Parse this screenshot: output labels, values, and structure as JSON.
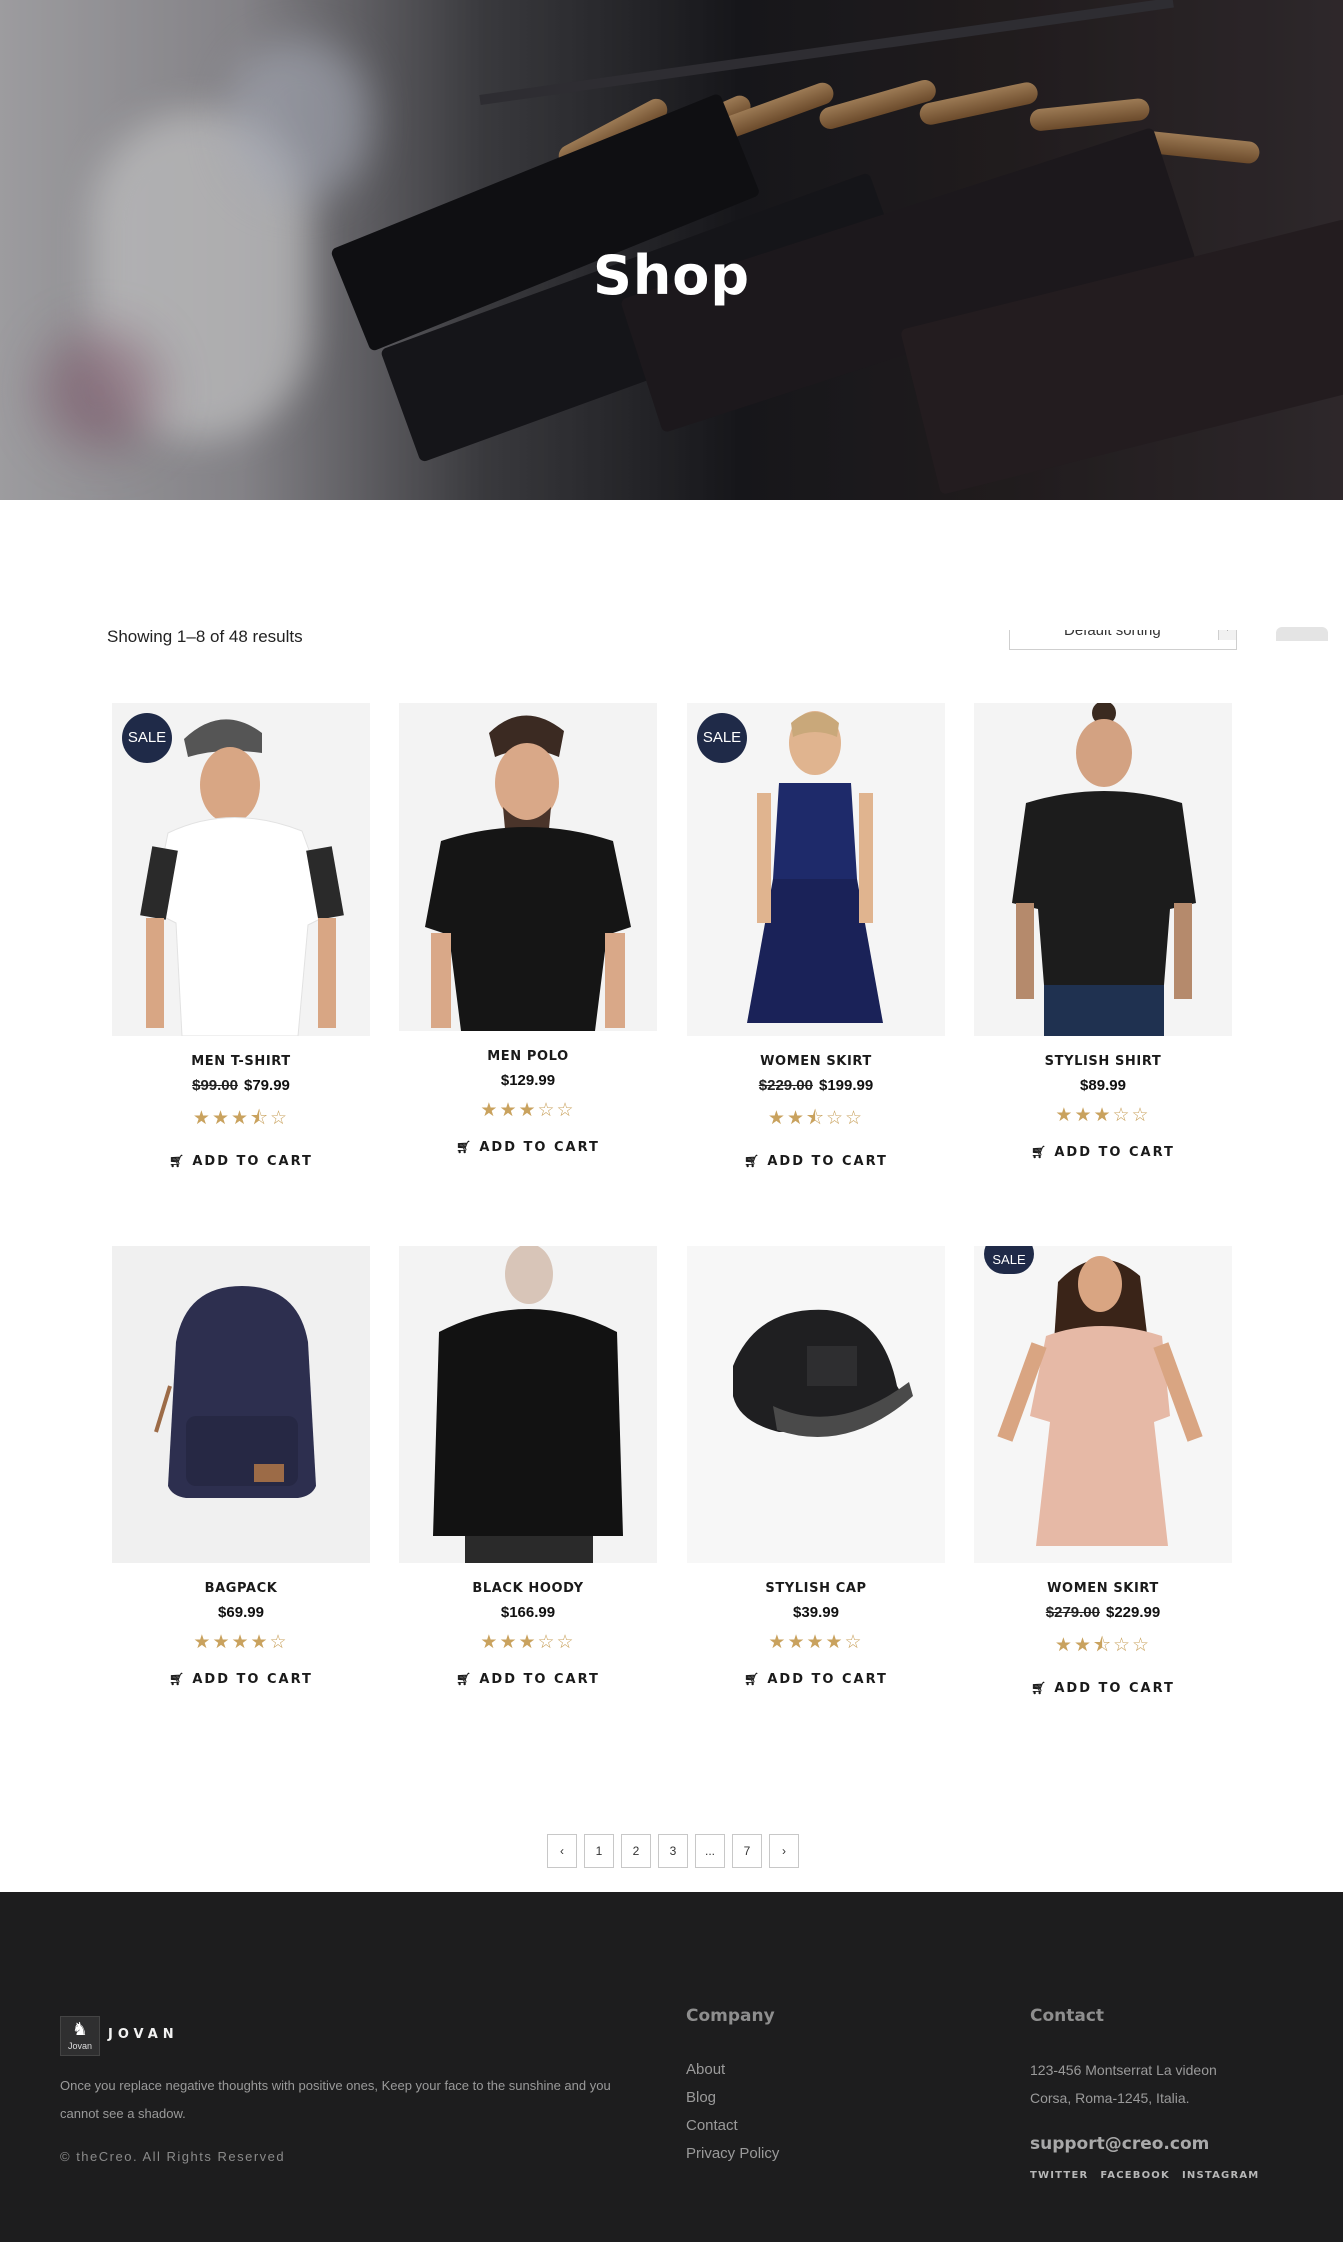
{
  "hero": {
    "title": "Shop"
  },
  "toolbar": {
    "result_count": "Showing 1–8 of 48 results",
    "sorting": "Default sorting"
  },
  "products": [
    {
      "name": "MEN T-SHIRT",
      "old_price": "$99.00",
      "price": "$79.99",
      "rating": "★★★⯪☆",
      "sale": "SALE",
      "cart": "ADD TO CART"
    },
    {
      "name": "MEN POLO",
      "old_price": "",
      "price": "$129.99",
      "rating": "★★★☆☆",
      "sale": "",
      "cart": "ADD TO CART"
    },
    {
      "name": "WOMEN SKIRT",
      "old_price": "$229.00",
      "price": "$199.99",
      "rating": "★★⯪☆☆",
      "sale": "SALE",
      "cart": "ADD TO CART"
    },
    {
      "name": "STYLISH SHIRT",
      "old_price": "",
      "price": "$89.99",
      "rating": "★★★☆☆",
      "sale": "",
      "cart": "ADD TO CART"
    },
    {
      "name": "BAGPACK",
      "old_price": "",
      "price": "$69.99",
      "rating": "★★★★☆",
      "sale": "",
      "cart": "ADD TO CART"
    },
    {
      "name": "BLACK HOODY",
      "old_price": "",
      "price": "$166.99",
      "rating": "★★★☆☆",
      "sale": "",
      "cart": "ADD TO CART"
    },
    {
      "name": "STYLISH CAP",
      "old_price": "",
      "price": "$39.99",
      "rating": "★★★★☆",
      "sale": "",
      "cart": "ADD TO CART"
    },
    {
      "name": "WOMEN SKIRT",
      "old_price": "$279.00",
      "price": "$229.99",
      "rating": "★★⯪☆☆",
      "sale": "SALE",
      "cart": "ADD TO CART"
    }
  ],
  "pagination": {
    "prev": "‹",
    "pages": [
      "1",
      "2",
      "3",
      "...",
      "7"
    ],
    "next": "›"
  },
  "footer": {
    "brand": "JOVAN",
    "logo_text": "Jovan",
    "tagline": "Once you replace negative thoughts with positive ones, Keep your face to the sunshine and you cannot see a shadow.",
    "copyright": "© theCreo. All Rights Reserved",
    "company_title": "Company",
    "company_links": [
      "About",
      "Blog",
      "Contact",
      "Privacy Policy"
    ],
    "contact_title": "Contact",
    "address_line1": "123-456 Montserrat La videon",
    "address_line2": "Corsa, Roma-1245, Italia.",
    "email": "support@creo.com",
    "socials": [
      "TWITTER",
      "FACEBOOK",
      "INSTAGRAM"
    ]
  },
  "colors": {
    "sale_badge": "#1f2a48",
    "stars": "#c9a25e",
    "footer_bg": "#1d1d1e"
  }
}
